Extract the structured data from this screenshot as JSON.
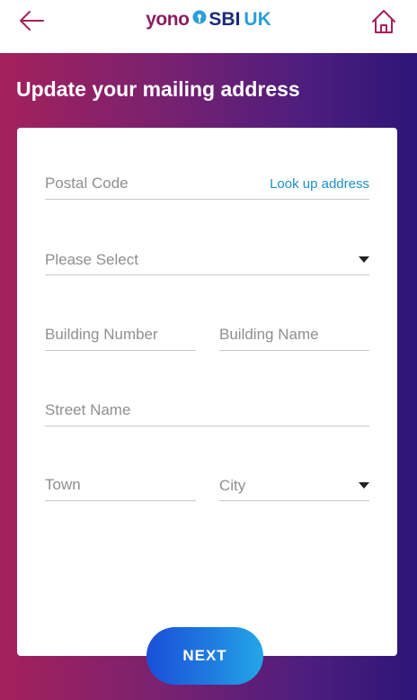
{
  "header": {
    "logo": {
      "yono": "yono",
      "sbi": "SBI",
      "region": "UK"
    },
    "back_icon": "arrow-left-icon",
    "home_icon": "home-icon"
  },
  "page": {
    "title": "Update your mailing address"
  },
  "form": {
    "postal_code": {
      "placeholder": "Postal Code",
      "value": ""
    },
    "lookup_link": "Look up address",
    "address_select": {
      "selected": "Please Select"
    },
    "building_number": {
      "placeholder": "Building Number",
      "value": ""
    },
    "building_name": {
      "placeholder": "Building Name",
      "value": ""
    },
    "street_name": {
      "placeholder": "Street Name",
      "value": ""
    },
    "town": {
      "placeholder": "Town",
      "value": ""
    },
    "city_select": {
      "selected": "City"
    }
  },
  "actions": {
    "next_label": "NEXT"
  },
  "colors": {
    "brand_magenta": "#8a1f64",
    "brand_blue": "#1a2a78",
    "accent_cyan": "#2a9fd8",
    "gradient_start": "#a4215c",
    "gradient_end": "#2d1577",
    "link": "#1d8fca"
  }
}
